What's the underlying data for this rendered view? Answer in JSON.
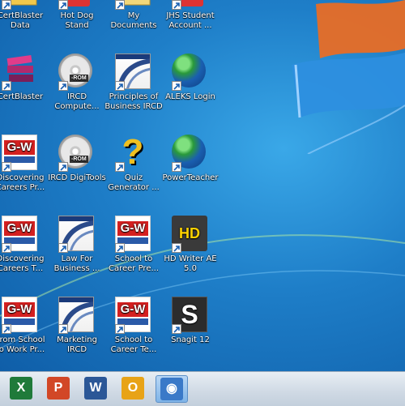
{
  "desktop": {
    "icons": [
      {
        "label": "CertBlaster\nData",
        "icon": "folder-icon"
      },
      {
        "label": "Hot Dog Stand",
        "icon": "app-icon"
      },
      {
        "label": "My Documents",
        "icon": "documents-icon"
      },
      {
        "label": "JHS Student\nAccount ...",
        "icon": "app-icon"
      },
      {
        "label": "CertBlaster",
        "icon": "books-stack-icon"
      },
      {
        "label": "IRCD\nCompute...",
        "icon": "cd-rom-icon"
      },
      {
        "label": "Principles of\nBusiness IRCD",
        "icon": "book-icon"
      },
      {
        "label": "ALEKS Login",
        "icon": "globe-icon"
      },
      {
        "label": "Discovering\nCareers Pr...",
        "icon": "gw-publisher-icon"
      },
      {
        "label": "IRCD DigiTools",
        "icon": "cd-rom-icon"
      },
      {
        "label": "Quiz\nGenerator ...",
        "icon": "question-mark-icon"
      },
      {
        "label": "PowerTeacher",
        "icon": "globe-icon"
      },
      {
        "label": "Discovering\nCareers T...",
        "icon": "gw-publisher-icon"
      },
      {
        "label": "Law For\nBusiness ...",
        "icon": "book-icon"
      },
      {
        "label": "School to\nCareer Pre...",
        "icon": "gw-publisher-icon"
      },
      {
        "label": "HD Writer AE\n5.0",
        "icon": "hd-writer-icon"
      },
      {
        "label": "From School\nto Work Pr...",
        "icon": "gw-publisher-icon"
      },
      {
        "label": "Marketing\nIRCD",
        "icon": "book-icon"
      },
      {
        "label": "School to\nCareer Te...",
        "icon": "gw-publisher-icon"
      },
      {
        "label": "Snagit 12",
        "icon": "snagit-icon"
      }
    ],
    "gw_text": "G-W",
    "rom_text": "-ROM",
    "quiz_glyph": "?",
    "snagit_glyph": "S",
    "hd_text": "HD"
  },
  "taskbar": {
    "items": [
      {
        "icon": "excel-icon",
        "glyph": "X",
        "color": "#1f7a3a"
      },
      {
        "icon": "powerpoint-icon",
        "glyph": "P",
        "color": "#d24726"
      },
      {
        "icon": "word-icon",
        "glyph": "W",
        "color": "#2b5797"
      },
      {
        "icon": "outlook-icon",
        "glyph": "O",
        "color": "#e8a317"
      },
      {
        "icon": "eye-icon",
        "glyph": "◉",
        "color": "#3a79c8"
      }
    ]
  }
}
